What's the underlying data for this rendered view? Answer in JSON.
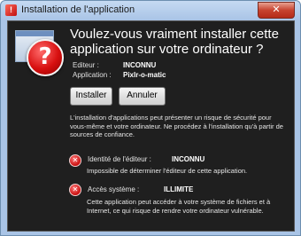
{
  "window": {
    "title": "Installation de l'application",
    "close_glyph": "✕"
  },
  "prompt": {
    "headline": "Voulez-vous vraiment installer cette application sur votre ordinateur ?",
    "publisher_label": "Editeur :",
    "publisher_value": "INCONNU",
    "application_label": "Application :",
    "application_value": "Pixlr-o-matic"
  },
  "buttons": {
    "install": "Installer",
    "cancel": "Annuler"
  },
  "warning_text": "L'installation d'applications peut présenter un risque de sécurité pour vous-même et votre ordinateur. Ne procédez à l'installation qu'à partir de sources de confiance.",
  "risks": [
    {
      "label": "Identité de l'éditeur :",
      "value": "INCONNU",
      "description": "Impossible de déterminer l'éditeur de cette application."
    },
    {
      "label": "Accès système :",
      "value": "ILLIMITE",
      "description": "Cette application peut accéder à votre système de fichiers et à Internet, ce qui risque de rendre votre ordinateur vulnérable."
    }
  ],
  "icons": {
    "app": "application-window-icon",
    "warning": "question-warning-icon",
    "risk": "error-x-icon",
    "warning_glyph": "?",
    "risk_glyph": "✕",
    "title_glyph": "!"
  },
  "colors": {
    "dialog_background": "#1f1f1f",
    "chrome": "#a9c4e6",
    "close_button": "#c7432f",
    "warning_red": "#d81010"
  }
}
